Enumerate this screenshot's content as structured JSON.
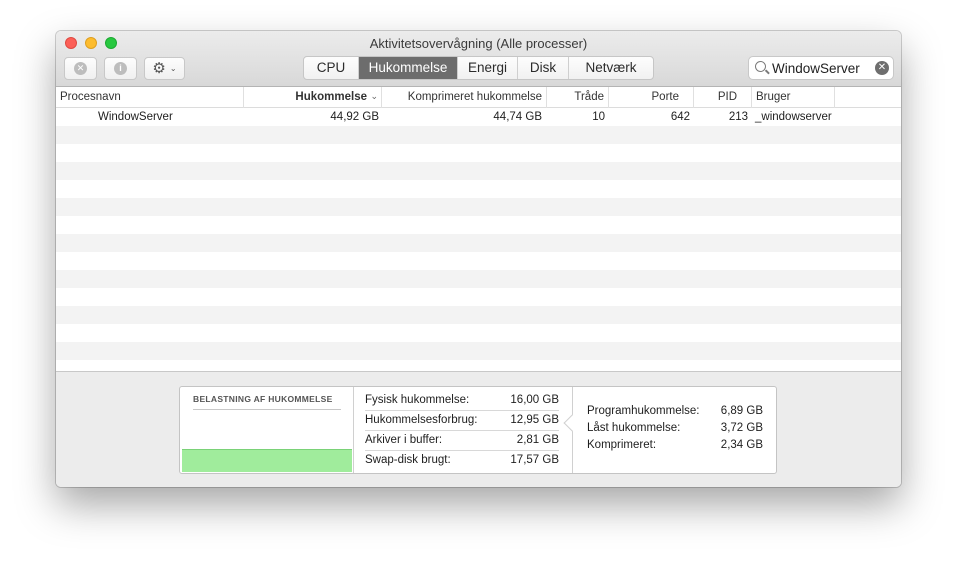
{
  "window": {
    "title": "Aktivitetsovervågning (Alle processer)"
  },
  "toolbar": {
    "stop_icon": "x-circle-icon",
    "info_icon": "info-icon",
    "gear_icon": "gear-icon",
    "stop_glyph": "✕",
    "info_glyph": "i",
    "gear_glyph": "⚙",
    "chevron_glyph": "⌄"
  },
  "tabs": [
    {
      "label": "CPU",
      "active": false
    },
    {
      "label": "Hukommelse",
      "active": true
    },
    {
      "label": "Energi",
      "active": false
    },
    {
      "label": "Disk",
      "active": false
    },
    {
      "label": "Netværk",
      "active": false
    }
  ],
  "search": {
    "value": "WindowServer",
    "clear_glyph": "✕"
  },
  "table": {
    "columns": [
      "Procesnavn",
      "Hukommelse",
      "Komprimeret hukommelse",
      "Tråde",
      "Porte",
      "PID",
      "Bruger"
    ],
    "sort_indicator": "⌄",
    "rows": [
      {
        "name": "WindowServer",
        "memory": "44,92 GB",
        "compressed": "44,74 GB",
        "threads": "10",
        "ports": "642",
        "pid": "213",
        "user": "_windowserver"
      }
    ]
  },
  "summary": {
    "pressure_title": "BELASTNING AF HUKOMMELSE",
    "pressure_color": "#a0ec9c",
    "stats": [
      {
        "label": "Fysisk hukommelse:",
        "value": "16,00 GB"
      },
      {
        "label": "Hukommelsesforbrug:",
        "value": "12,95 GB"
      },
      {
        "label": "Arkiver i buffer:",
        "value": "2,81 GB"
      },
      {
        "label": "Swap-disk brugt:",
        "value": "17,57 GB"
      }
    ],
    "breakdown": [
      {
        "label": "Programhukommelse:",
        "value": "6,89 GB"
      },
      {
        "label": "Låst hukommelse:",
        "value": "3,72 GB"
      },
      {
        "label": "Komprimeret:",
        "value": "2,34 GB"
      }
    ]
  }
}
